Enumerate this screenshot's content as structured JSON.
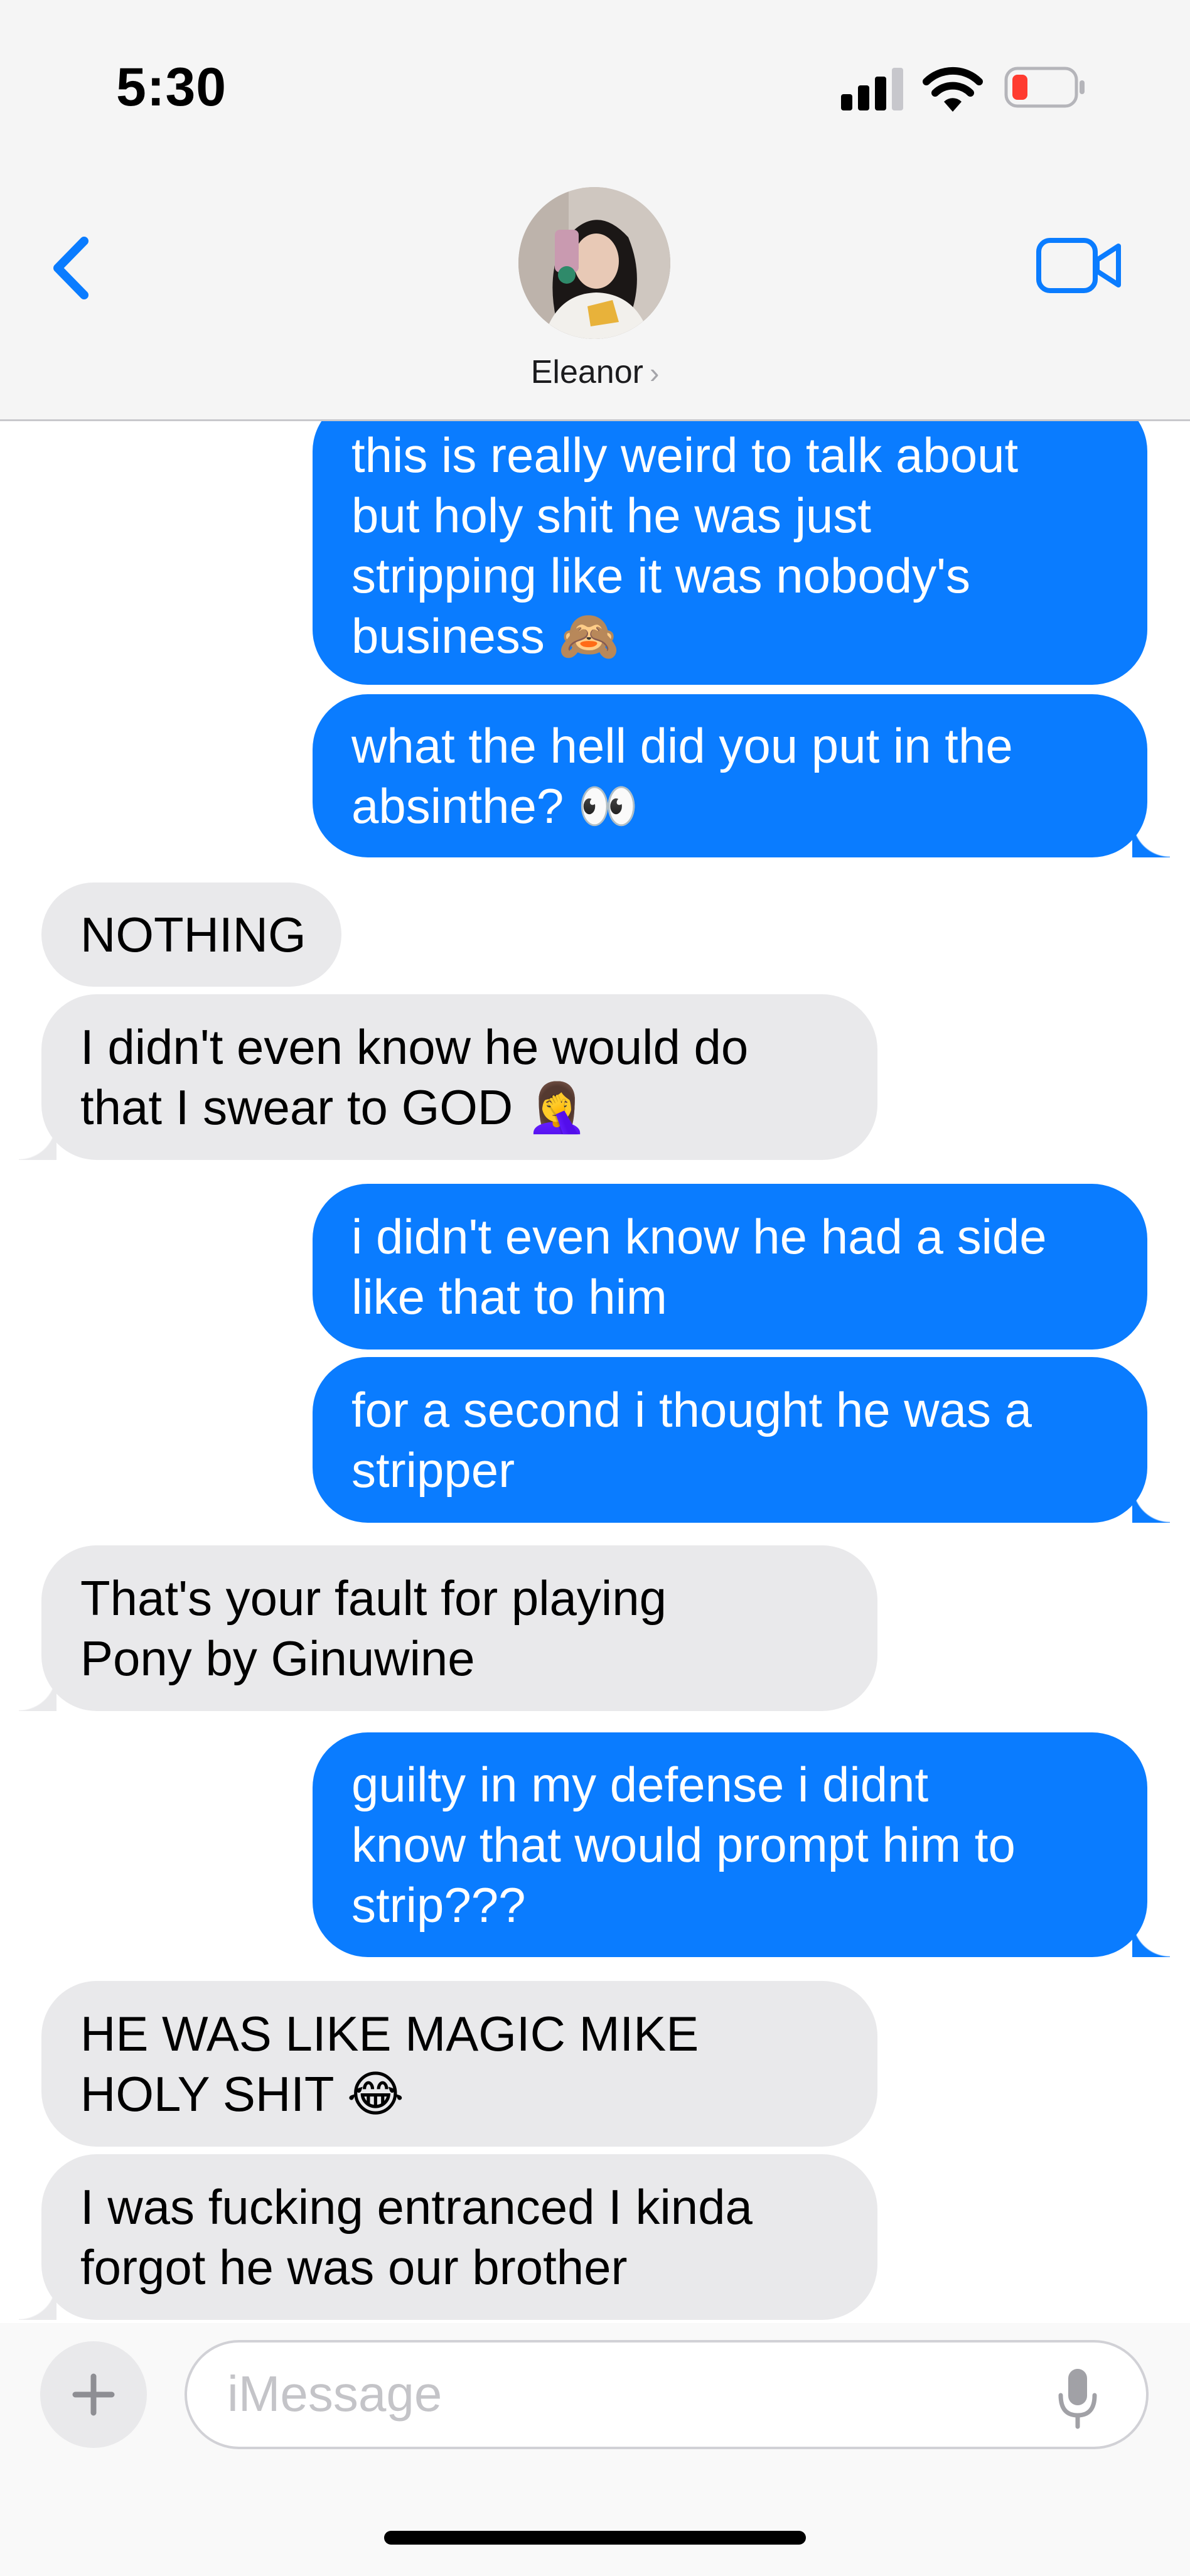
{
  "status_bar": {
    "time": "5:30",
    "signal_icon": "cellular-signal-icon",
    "wifi_icon": "wifi-icon",
    "battery_icon": "battery-low-icon",
    "battery_color": "#ff3b30"
  },
  "header": {
    "back_icon": "chevron-left-icon",
    "contact_name": "Eleanor",
    "contact_chevron": "›",
    "video_icon": "facetime-video-icon",
    "accent": "#0a7cff"
  },
  "messages": [
    {
      "sender": "me",
      "text": "this is really weird to talk about\nbut holy shit he was just\nstripping like it was nobody's\nbusiness 🙈"
    },
    {
      "sender": "me",
      "text": "what the hell did you put in the\nabsinthe? 👀"
    },
    {
      "sender": "Eleanor",
      "text": "NOTHING"
    },
    {
      "sender": "Eleanor",
      "text": "I didn't even know he would do\nthat I swear to GOD 🤦‍♀️"
    },
    {
      "sender": "me",
      "text": "i didn't even know he had a side\nlike that to him"
    },
    {
      "sender": "me",
      "text": "for a second i thought he was a\nstripper"
    },
    {
      "sender": "Eleanor",
      "text": "That's your fault for playing\nPony by Ginuwine"
    },
    {
      "sender": "me",
      "text": "guilty in my defense i didnt\nknow that would prompt him to\nstrip???"
    },
    {
      "sender": "Eleanor",
      "text": "HE WAS LIKE MAGIC MIKE\nHOLY SHIT 😂"
    },
    {
      "sender": "Eleanor",
      "text": "I was fucking entranced I kinda\nforgot he was our brother"
    }
  ],
  "input": {
    "plus_label": "+",
    "placeholder": "iMessage",
    "mic_icon": "microphone-icon"
  },
  "colors": {
    "sent_bubble": "#0a7cff",
    "received_bubble": "#e9e9eb"
  }
}
